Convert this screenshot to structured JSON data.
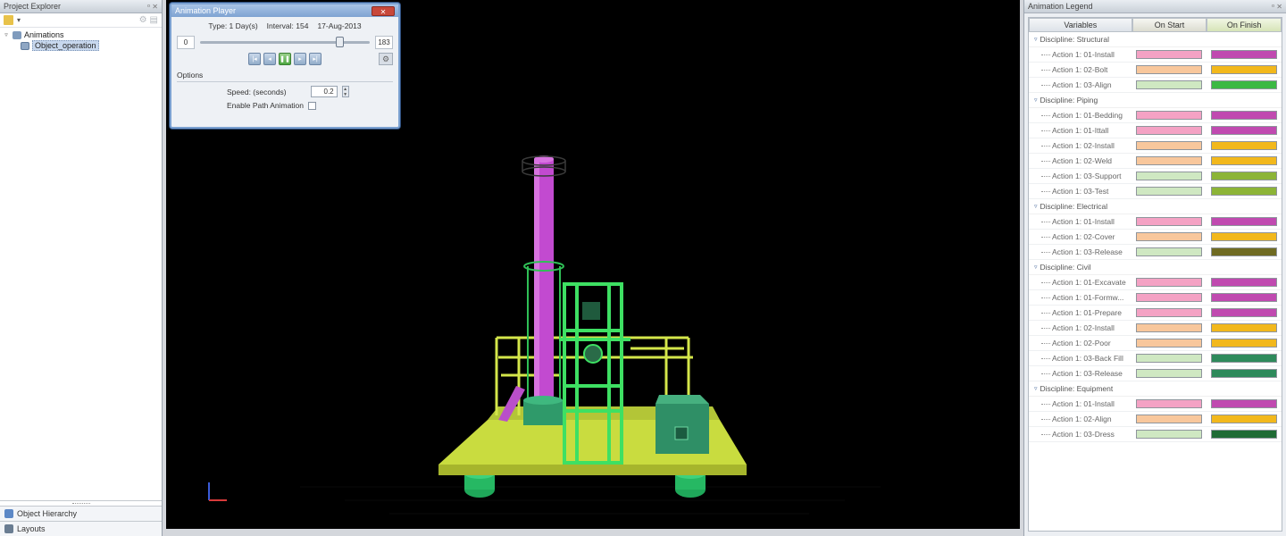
{
  "project_explorer": {
    "title": "Project Explorer",
    "controls": "ᵒ ✕",
    "tree": {
      "root": "Animations",
      "child": "Object_operation"
    },
    "bottom_tabs": [
      "Object Hierarchy",
      "Layouts"
    ]
  },
  "animation_player": {
    "title": "Animation Player",
    "close": "✕",
    "type_text": "Type: 1 Day(s)",
    "interval_text": "Interval: 154",
    "date_text": "17-Aug-2013",
    "slider_min": "0",
    "slider_max": "183",
    "slider_value": 154,
    "options_label": "Options",
    "speed_label": "Speed: (seconds)",
    "speed_value": "0.2",
    "path_animation_label": "Enable Path Animation"
  },
  "animation_legend": {
    "title": "Animation Legend",
    "controls": "ᵒ ✕",
    "columns": [
      "Variables",
      "On Start",
      "On Finish"
    ],
    "disciplines": [
      {
        "label": "Discipline: Structural",
        "actions": [
          {
            "label": "Action 1: 01-Install",
            "start": "#f4a2c4",
            "finish": "#c04ab0"
          },
          {
            "label": "Action 1: 02-Bolt",
            "start": "#f8c79c",
            "finish": "#f2b81c"
          },
          {
            "label": "Action 1: 03-Align",
            "start": "#cfe8c2",
            "finish": "#3cb944"
          }
        ]
      },
      {
        "label": "Discipline: Piping",
        "actions": [
          {
            "label": "Action 1: 01-Bedding",
            "start": "#f4a2c4",
            "finish": "#c04ab0"
          },
          {
            "label": "Action 1: 01-Ittall",
            "start": "#f4a2c4",
            "finish": "#c04ab0"
          },
          {
            "label": "Action 1: 02-Install",
            "start": "#f8c79c",
            "finish": "#f2b81c"
          },
          {
            "label": "Action 1: 02-Weld",
            "start": "#f8c79c",
            "finish": "#f2b81c"
          },
          {
            "label": "Action 1: 03-Support",
            "start": "#cfe8c2",
            "finish": "#8cb437"
          },
          {
            "label": "Action 1: 03-Test",
            "start": "#cfe8c2",
            "finish": "#8cb437"
          }
        ]
      },
      {
        "label": "Discipline: Electrical",
        "actions": [
          {
            "label": "Action 1: 01-Install",
            "start": "#f4a2c4",
            "finish": "#c04ab0"
          },
          {
            "label": "Action 1: 02-Cover",
            "start": "#f8c79c",
            "finish": "#f2b81c"
          },
          {
            "label": "Action 1: 03-Release",
            "start": "#cfe8c2",
            "finish": "#6f6b22"
          }
        ]
      },
      {
        "label": "Discipline: Civil",
        "actions": [
          {
            "label": "Action 1: 01-Excavate",
            "start": "#f4a2c4",
            "finish": "#c04ab0"
          },
          {
            "label": "Action 1: 01-Formw...",
            "start": "#f4a2c4",
            "finish": "#c04ab0"
          },
          {
            "label": "Action 1: 01-Prepare",
            "start": "#f4a2c4",
            "finish": "#c04ab0"
          },
          {
            "label": "Action 1: 02-Install",
            "start": "#f8c79c",
            "finish": "#f2b81c"
          },
          {
            "label": "Action 1: 02-Poor",
            "start": "#f8c79c",
            "finish": "#f2b81c"
          },
          {
            "label": "Action 1: 03-Back Fill",
            "start": "#cfe8c2",
            "finish": "#2e8a5b"
          },
          {
            "label": "Action 1: 03-Release",
            "start": "#cfe8c2",
            "finish": "#2e8a5b"
          }
        ]
      },
      {
        "label": "Discipline: Equipment",
        "actions": [
          {
            "label": "Action 1: 01-Install",
            "start": "#f4a2c4",
            "finish": "#c04ab0"
          },
          {
            "label": "Action 1: 02-Align",
            "start": "#f8c79c",
            "finish": "#f2b81c"
          },
          {
            "label": "Action 1: 03-Dress",
            "start": "#cfe8c2",
            "finish": "#1f6b35"
          }
        ]
      }
    ]
  },
  "colors": {
    "structure_green": "#3ee063",
    "platform_yellow": "#d4e64a",
    "column_magenta": "#c24ad0",
    "equipment_teal": "#2f9a6a",
    "viewport_bg": "#000000"
  }
}
